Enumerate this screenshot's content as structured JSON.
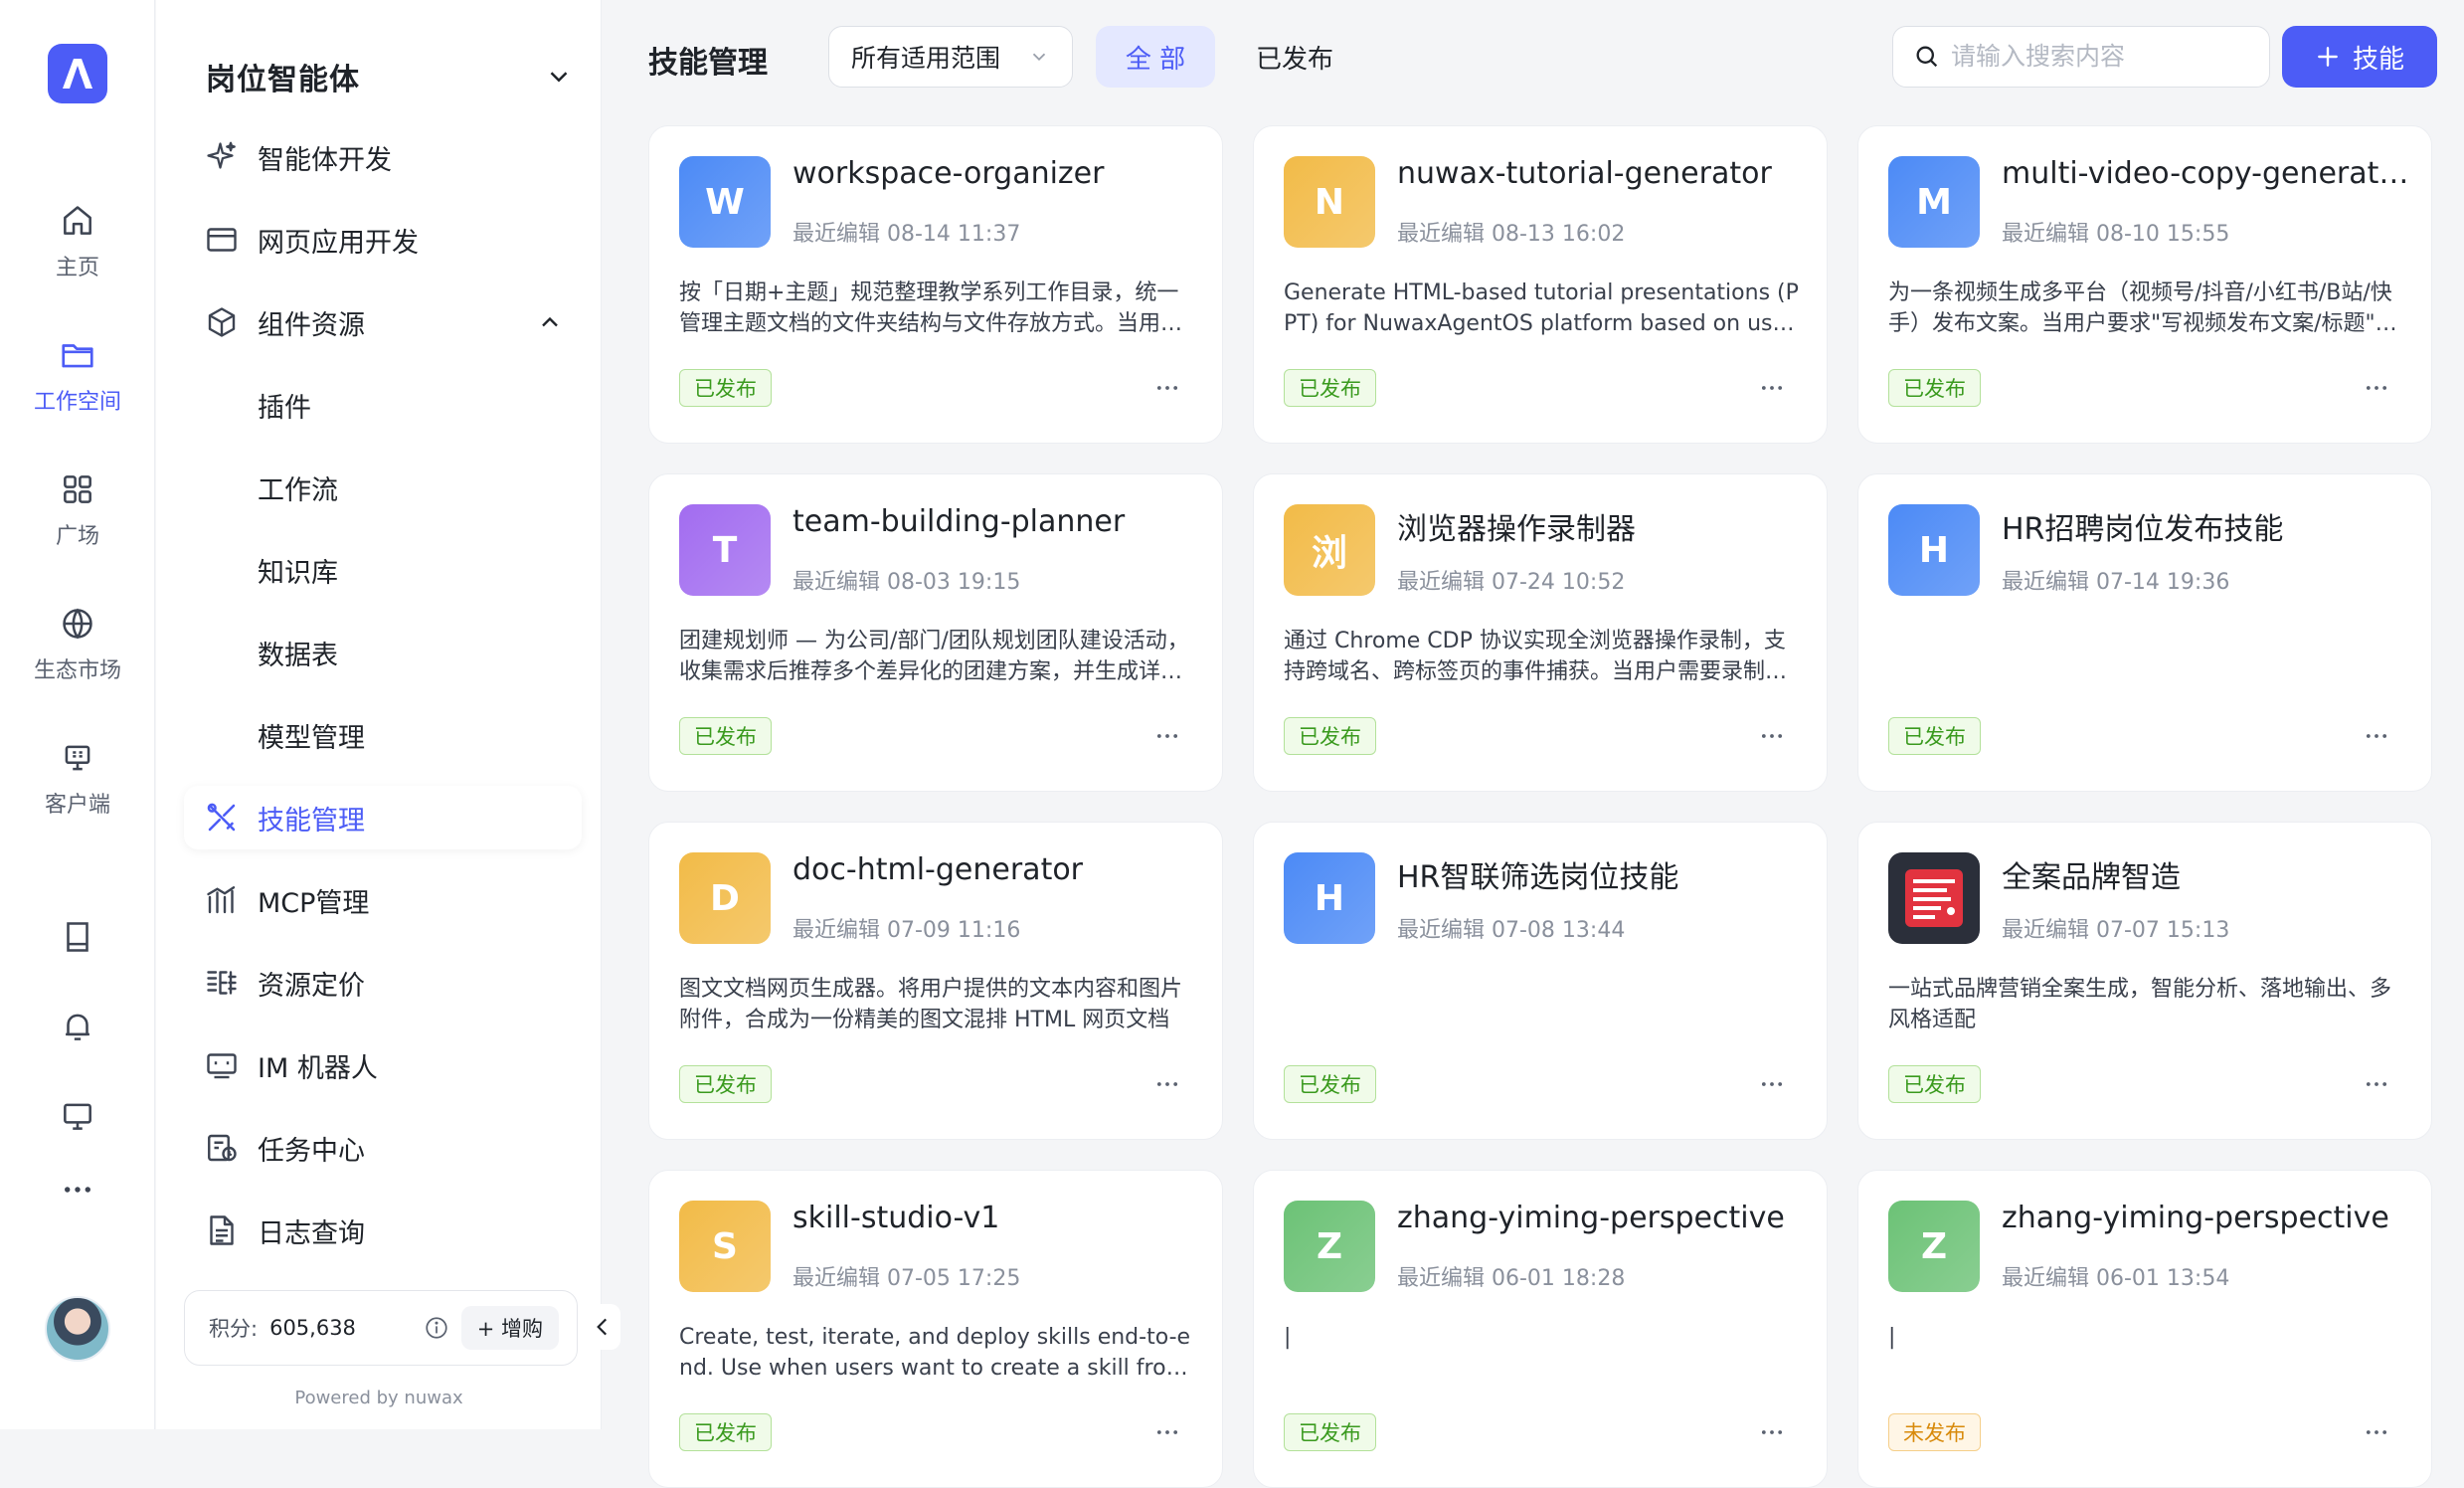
{
  "rail": {
    "items": [
      {
        "label": "主页",
        "icon": "home-icon"
      },
      {
        "label": "工作空间",
        "icon": "folder-icon",
        "active": true
      },
      {
        "label": "广场",
        "icon": "grid-icon"
      },
      {
        "label": "生态市场",
        "icon": "globe-icon"
      },
      {
        "label": "客户端",
        "icon": "monitor-icon"
      }
    ],
    "extra_icons": [
      "book-icon",
      "bell-icon",
      "desktop-icon",
      "more-icon"
    ]
  },
  "sidebar": {
    "header_title": "岗位智能体",
    "items": [
      {
        "label": "智能体开发",
        "icon": "sparkle-icon"
      },
      {
        "label": "网页应用开发",
        "icon": "browser-window-icon"
      },
      {
        "label": "组件资源",
        "icon": "cube-icon",
        "expanded": true
      },
      {
        "label": "插件",
        "sub": true
      },
      {
        "label": "工作流",
        "sub": true
      },
      {
        "label": "知识库",
        "sub": true
      },
      {
        "label": "数据表",
        "sub": true
      },
      {
        "label": "模型管理",
        "sub": true
      },
      {
        "label": "技能管理",
        "icon": "tools-icon",
        "active": true
      },
      {
        "label": "MCP管理",
        "icon": "mcp-icon"
      },
      {
        "label": "资源定价",
        "icon": "pricing-icon"
      },
      {
        "label": "IM 机器人",
        "icon": "robot-icon"
      },
      {
        "label": "任务中心",
        "icon": "task-icon"
      },
      {
        "label": "日志查询",
        "icon": "log-icon"
      }
    ],
    "points_label": "积分:",
    "points_value": "605,638",
    "buy_label": "+ 增购",
    "powered_by": "Powered by nuwax"
  },
  "main": {
    "title": "技能管理",
    "scope_select": "所有适用范围",
    "filter_all": "全 部",
    "filter_published": "已发布",
    "search_placeholder": "请输入搜索内容",
    "add_button": "技能"
  },
  "cards": [
    {
      "letter": "W",
      "name": "workspace-organizer",
      "edited": "最近编辑 08-14 11:37",
      "desc": "按「日期+主题」规范整理教学系列工作目录，统一管理主题文档的文件夹结构与文件存放方式。当用户需要整理工作目录时使用",
      "status": "已发布",
      "color": "#4c8af6"
    },
    {
      "letter": "N",
      "name": "nuwax-tutorial-generator",
      "edited": "最近编辑 08-13 16:02",
      "desc": "Generate HTML-based tutorial presentations (PPT) for NuwaxAgentOS platform based on user manual content",
      "status": "已发布",
      "color": "#f2bb48"
    },
    {
      "letter": "M",
      "name": "multi-video-copy-generator",
      "edited": "最近编辑 08-10 15:55",
      "desc": "为一条视频生成多平台（视频号/抖音/小红书/B站/快手）发布文案。当用户要求\"写视频发布文案/标题\"时使用",
      "status": "已发布",
      "color": "#4c8af6"
    },
    {
      "letter": "T",
      "name": "team-building-planner",
      "edited": "最近编辑 08-03 19:15",
      "desc": "团建规划师 — 为公司/部门/团队规划团队建设活动，收集需求后推荐多个差异化的团建方案，并生成详细执行清单",
      "status": "已发布",
      "color": "#a26cf0"
    },
    {
      "letter": "浏",
      "name": "浏览器操作录制器",
      "edited": "最近编辑 07-24 10:52",
      "desc": "通过 Chrome CDP 协议实现全浏览器操作录制，支持跨域名、跨标签页的事件捕获。当用户需要录制浏览器操作时使用",
      "status": "已发布",
      "color": "#f2bb48"
    },
    {
      "letter": "H",
      "name": "HR招聘岗位发布技能",
      "edited": "最近编辑 07-14 19:36",
      "desc": "",
      "status": "已发布",
      "color": "#4c8af6"
    },
    {
      "letter": "D",
      "name": "doc-html-generator",
      "edited": "最近编辑 07-09 11:16",
      "desc": "图文文档网页生成器。将用户提供的文本内容和图片附件，合成为一份精美的图文混排 HTML 网页文档",
      "status": "已发布",
      "color": "#f2bb48"
    },
    {
      "letter": "H",
      "name": "HR智联筛选岗位技能",
      "edited": "最近编辑 07-08 13:44",
      "desc": "",
      "status": "已发布",
      "color": "#4c8af6"
    },
    {
      "letter": "",
      "name": "全案品牌智造",
      "edited": "最近编辑 07-07 15:13",
      "desc": "一站式品牌营销全案生成，智能分析、落地输出、多风格适配",
      "status": "已发布",
      "color": "#2b2f3a",
      "image": true
    },
    {
      "letter": "S",
      "name": "skill-studio-v1",
      "edited": "最近编辑 07-05 17:25",
      "desc": "Create, test, iterate, and deploy skills end-to-end. Use when users want to create a skill from scratch, or improve one",
      "status": "已发布",
      "color": "#f2bb48"
    },
    {
      "letter": "Z",
      "name": "zhang-yiming-perspective",
      "edited": "最近编辑 06-01 18:28",
      "desc": "|",
      "status": "已发布",
      "color": "#6cc276"
    },
    {
      "letter": "Z",
      "name": "zhang-yiming-perspective",
      "edited": "最近编辑 06-01 13:54",
      "desc": "|",
      "status": "未发布",
      "color": "#6cc276",
      "status_color": "orange"
    }
  ]
}
